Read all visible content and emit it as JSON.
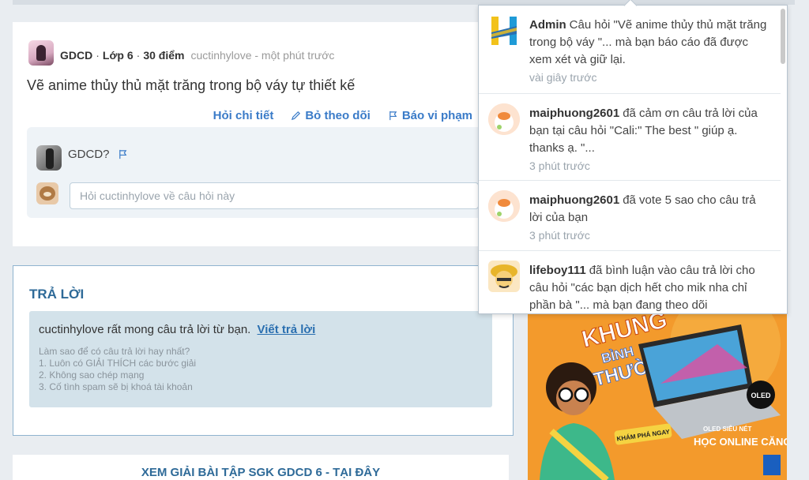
{
  "question": {
    "subject": "GDCD",
    "grade": "Lớp 6",
    "points": "30 điểm",
    "author_meta": "cuctinhylove - một phút trước",
    "title": "Vẽ anime thủy thủ mặt trăng trong bộ váy tự thiết kế",
    "actions": {
      "detail": "Hỏi chi tiết",
      "unfollow": "Bỏ theo dõi",
      "report": "Báo vi phạm"
    },
    "comment_text": "GDCD?",
    "comment_placeholder": "Hỏi cuctinhylove về câu hỏi này"
  },
  "answer": {
    "title": "TRẢ LỜI",
    "prompt": "cuctinhylove rất mong câu trả lời từ bạn.",
    "write_link": "Viết trả lời",
    "how_to": "Làm sao để có câu trả lời hay nhất?",
    "tips": [
      "1. Luôn có GIẢI THÍCH các bước giải",
      "2. Không sao chép mạng",
      "3. Cố tình spam sẽ bị khoá tài khoản"
    ]
  },
  "bottom_link": "XEM GIẢI BÀI TẬP SGK GDCD 6 - TẠI ĐÂY",
  "notifications": [
    {
      "user": "Admin",
      "text": "Câu hỏi \"Vẽ anime thủy thủ mặt trăng trong bộ váy \"... mà bạn báo cáo đã được xem xét và giữ lại.",
      "time": "vài giây trước",
      "avatar": "hoc-logo-icon"
    },
    {
      "user": "maiphuong2601",
      "text": "đã cảm ơn câu trả lời của bạn tại câu hỏi \"Cali:\" The best \" giúp ạ. thanks ạ. \"...",
      "time": "3 phút trước",
      "avatar": "peach-avatar-icon"
    },
    {
      "user": "maiphuong2601",
      "text": "đã vote 5 sao cho câu trả lời của bạn",
      "time": "3 phút trước",
      "avatar": "peach-avatar-icon"
    },
    {
      "user": "lifeboy111",
      "text": "đã bình luận vào câu trả lời cho câu hỏi \"các bạn dịch hết cho mik nha chỉ phần bà \"... mà bạn đang theo dõi",
      "time": "",
      "avatar": "cartoon-avatar-icon"
    }
  ],
  "ad": {
    "headline": "KHUNG BÌNH THƯỜNG",
    "cta": "KHÁM PHÁ NGAY",
    "badge": "OLED",
    "tagline": "OLED SIÊU NÉT HỌC ONLINE CĂNG ĐÉT"
  },
  "colors": {
    "link_blue": "#3a7bc8",
    "title_blue": "#2e6a98",
    "ad_orange": "#f39a2c"
  }
}
